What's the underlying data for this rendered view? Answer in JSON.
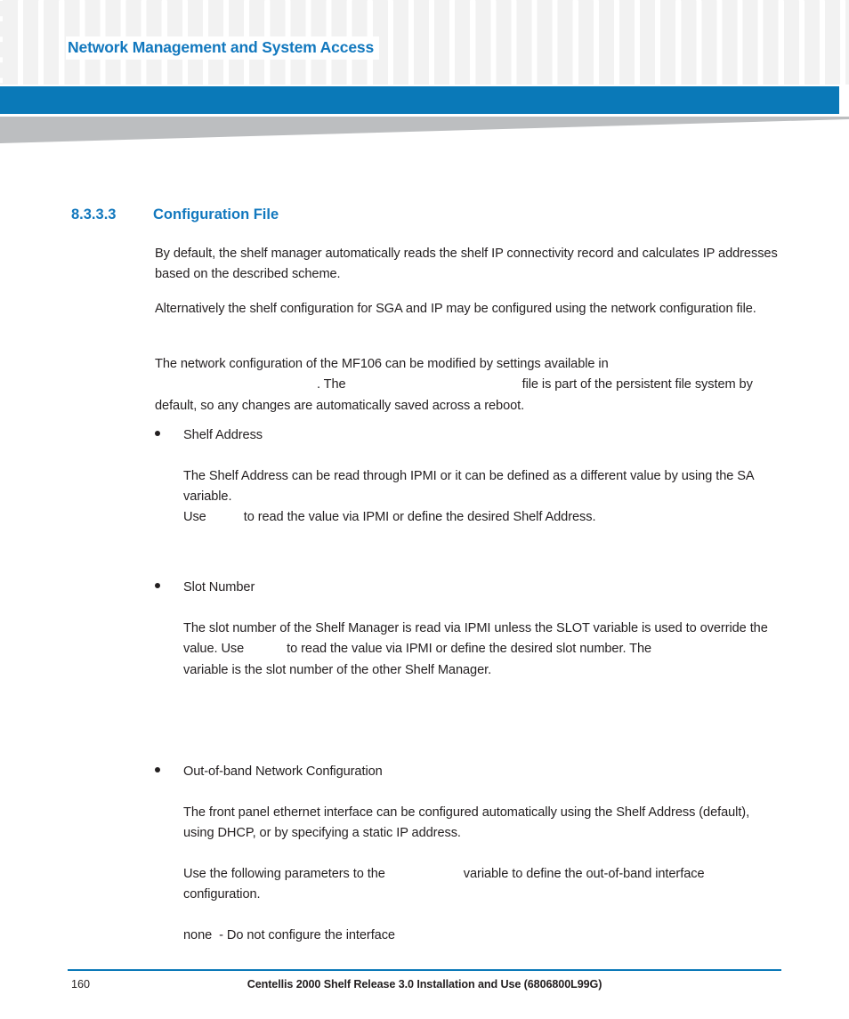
{
  "header": {
    "running_title": "Network Management and System Access",
    "accent_color": "#1278be",
    "band_color": "#0a79b8",
    "wedge_color": "#bcbec0"
  },
  "section": {
    "number": "8.3.3.3",
    "title": "Configuration File"
  },
  "body": {
    "p1": "By default, the shelf manager automatically reads the shelf IP connectivity record and calculates IP addresses based on the described scheme.",
    "p2": "Alternatively the shelf configuration for SGA and IP may be configured using the network configuration file.",
    "p3_a": "The network configuration of the MF106 can be modified by settings available in",
    "p3_b": ". The",
    "p3_c": "file is part of the persistent file system by default, so any changes are automatically saved across a reboot."
  },
  "bullets": [
    {
      "label": "Shelf Address",
      "para_a": "The Shelf Address can be read through IPMI or it can be defined as a different value by using the SA variable.",
      "para_b": "Use",
      "para_c": "to read the value via IPMI or define the desired Shelf Address."
    },
    {
      "label": "Slot Number",
      "para_a": "The slot number of the Shelf Manager is read via IPMI unless the SLOT variable is used to override the value. Use",
      "para_b": "to read the value via IPMI or define the desired slot number. The",
      "para_c": "variable is the slot number of the other Shelf Manager."
    },
    {
      "label": "Out-of-band Network Configuration",
      "para_a": "The front panel ethernet interface can be configured automatically using the Shelf Address (default), using DHCP, or by specifying a static IP address.",
      "para_b": "Use the following parameters to the",
      "para_c": "variable to define the out-of-band interface configuration.",
      "option_name": "none",
      "option_desc": "- Do not configure the interface"
    }
  ],
  "footer": {
    "page_number": "160",
    "document_title": "Centellis 2000 Shelf Release 3.0 Installation and Use (6806800L99G)"
  }
}
